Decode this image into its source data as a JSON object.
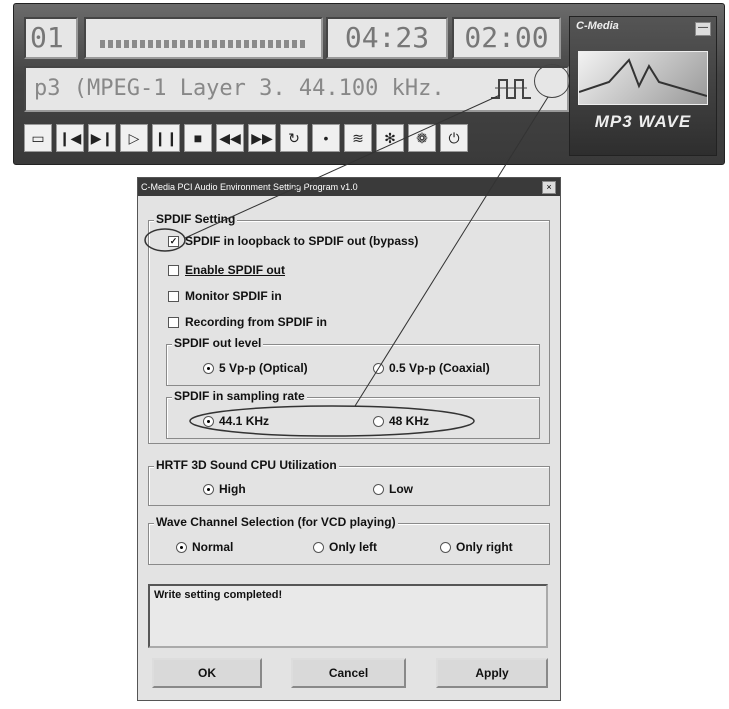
{
  "player": {
    "track": "01",
    "time_elapsed": "04:23",
    "time_remaining": "02:00",
    "info": "p3 (MPEG-1 Layer 3. 44.100 kHz.",
    "brand_name": "C-Media",
    "logo_text": "MP3 WAVE",
    "controls": [
      "open-icon",
      "previous-icon",
      "next-icon",
      "play-icon",
      "pause-icon",
      "stop-icon",
      "rewind-icon",
      "fast-forward-icon",
      "repeat-icon",
      "record-icon",
      "equalizer-icon",
      "settings-icon",
      "effects-icon",
      "power-icon"
    ]
  },
  "dialog": {
    "title": "C-Media PCI Audio Environment Setting Program v1.0",
    "spdif_group": "SPDIF Setting",
    "loopback": {
      "label": "SPDIF in loopback to SPDIF out (bypass)",
      "checked": true
    },
    "enable_out": {
      "label": "Enable SPDIF out",
      "checked": false
    },
    "monitor_in": {
      "label": "Monitor SPDIF in",
      "checked": false
    },
    "record_in": {
      "label": "Recording from SPDIF in",
      "checked": false
    },
    "out_level_group": "SPDIF out level",
    "out_level_options": [
      "5 Vp-p (Optical)",
      "0.5 Vp-p (Coaxial)"
    ],
    "out_level_selected": 0,
    "sampling_group": "SPDIF in sampling rate",
    "sampling_options": [
      "44.1 KHz",
      "48 KHz"
    ],
    "sampling_selected": 0,
    "hrtf_group": "HRTF 3D Sound CPU Utilization",
    "hrtf_options": [
      "High",
      "Low"
    ],
    "hrtf_selected": 0,
    "wave_group": "Wave Channel Selection (for VCD playing)",
    "wave_options": [
      "Normal",
      "Only left",
      "Only right"
    ],
    "wave_selected": 0,
    "status": "Write setting completed!",
    "ok": "OK",
    "cancel": "Cancel",
    "apply": "Apply"
  }
}
